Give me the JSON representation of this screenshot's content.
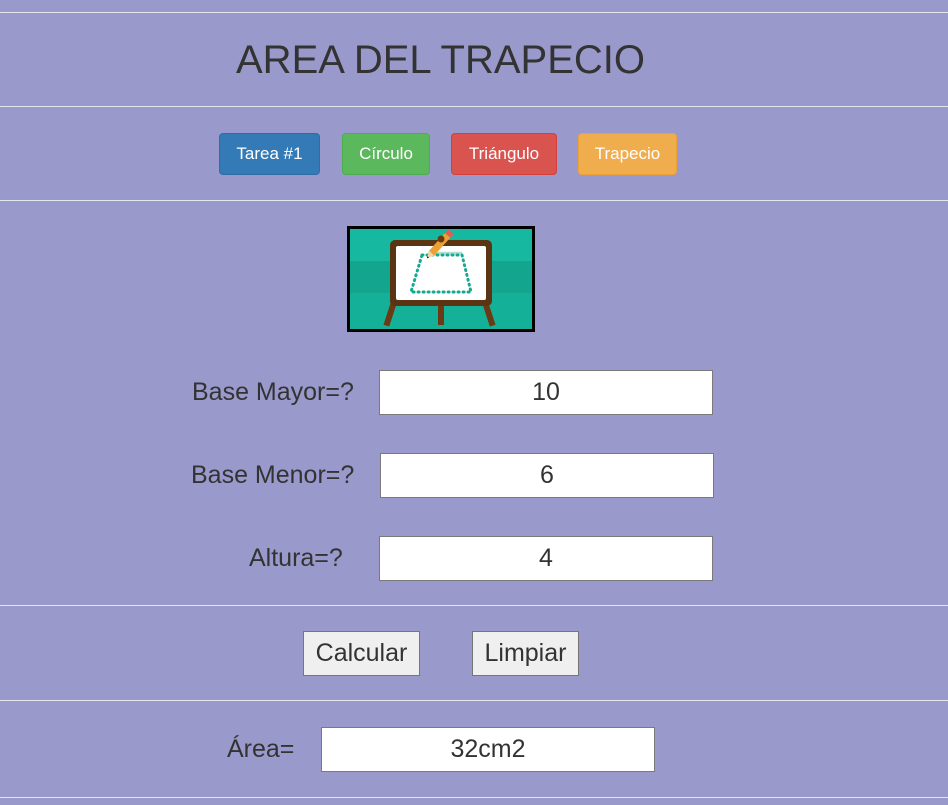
{
  "header": {
    "title": "AREA DEL TRAPECIO"
  },
  "nav": {
    "buttons": [
      {
        "label": "Tarea #1",
        "color": "#337ab7"
      },
      {
        "label": "Círculo",
        "color": "#5cb85c"
      },
      {
        "label": "Triángulo",
        "color": "#d9534f"
      },
      {
        "label": "Trapecio",
        "color": "#f0ad4e"
      }
    ]
  },
  "logo": {
    "icon": "easel-trapezoid-icon",
    "background": "#16b9a0"
  },
  "form": {
    "base_mayor": {
      "label": "Base Mayor=?",
      "value": "10"
    },
    "base_menor": {
      "label": "Base Menor=?",
      "value": "6"
    },
    "altura": {
      "label": "Altura=?",
      "value": "4"
    }
  },
  "actions": {
    "calcular": "Calcular",
    "limpiar": "Limpiar"
  },
  "result": {
    "label": "Área=",
    "value": "32cm2"
  },
  "colors": {
    "page_background": "#9999cc",
    "divider": "#e6e6ee",
    "text": "#333333"
  }
}
